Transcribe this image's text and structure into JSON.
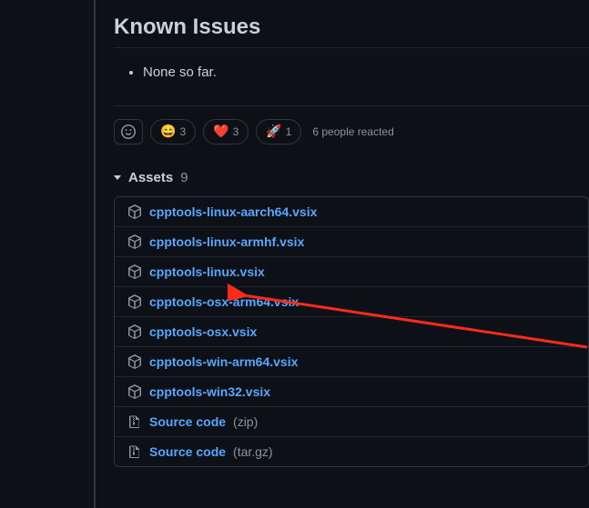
{
  "heading": "Known Issues",
  "issues": [
    "None so far."
  ],
  "reactions": {
    "items": [
      {
        "emoji": "😄",
        "count": 3
      },
      {
        "emoji": "❤️",
        "count": 3
      },
      {
        "emoji": "🚀",
        "count": 1
      }
    ],
    "summary": "6 people reacted"
  },
  "assets": {
    "label": "Assets",
    "count": 9,
    "items": [
      {
        "name": "cpptools-linux-aarch64.vsix",
        "kind": "package"
      },
      {
        "name": "cpptools-linux-armhf.vsix",
        "kind": "package"
      },
      {
        "name": "cpptools-linux.vsix",
        "kind": "package"
      },
      {
        "name": "cpptools-osx-arm64.vsix",
        "kind": "package"
      },
      {
        "name": "cpptools-osx.vsix",
        "kind": "package"
      },
      {
        "name": "cpptools-win-arm64.vsix",
        "kind": "package"
      },
      {
        "name": "cpptools-win32.vsix",
        "kind": "package"
      },
      {
        "name": "Source code",
        "ext": "(zip)",
        "kind": "zip"
      },
      {
        "name": "Source code",
        "ext": "(tar.gz)",
        "kind": "zip"
      }
    ]
  }
}
